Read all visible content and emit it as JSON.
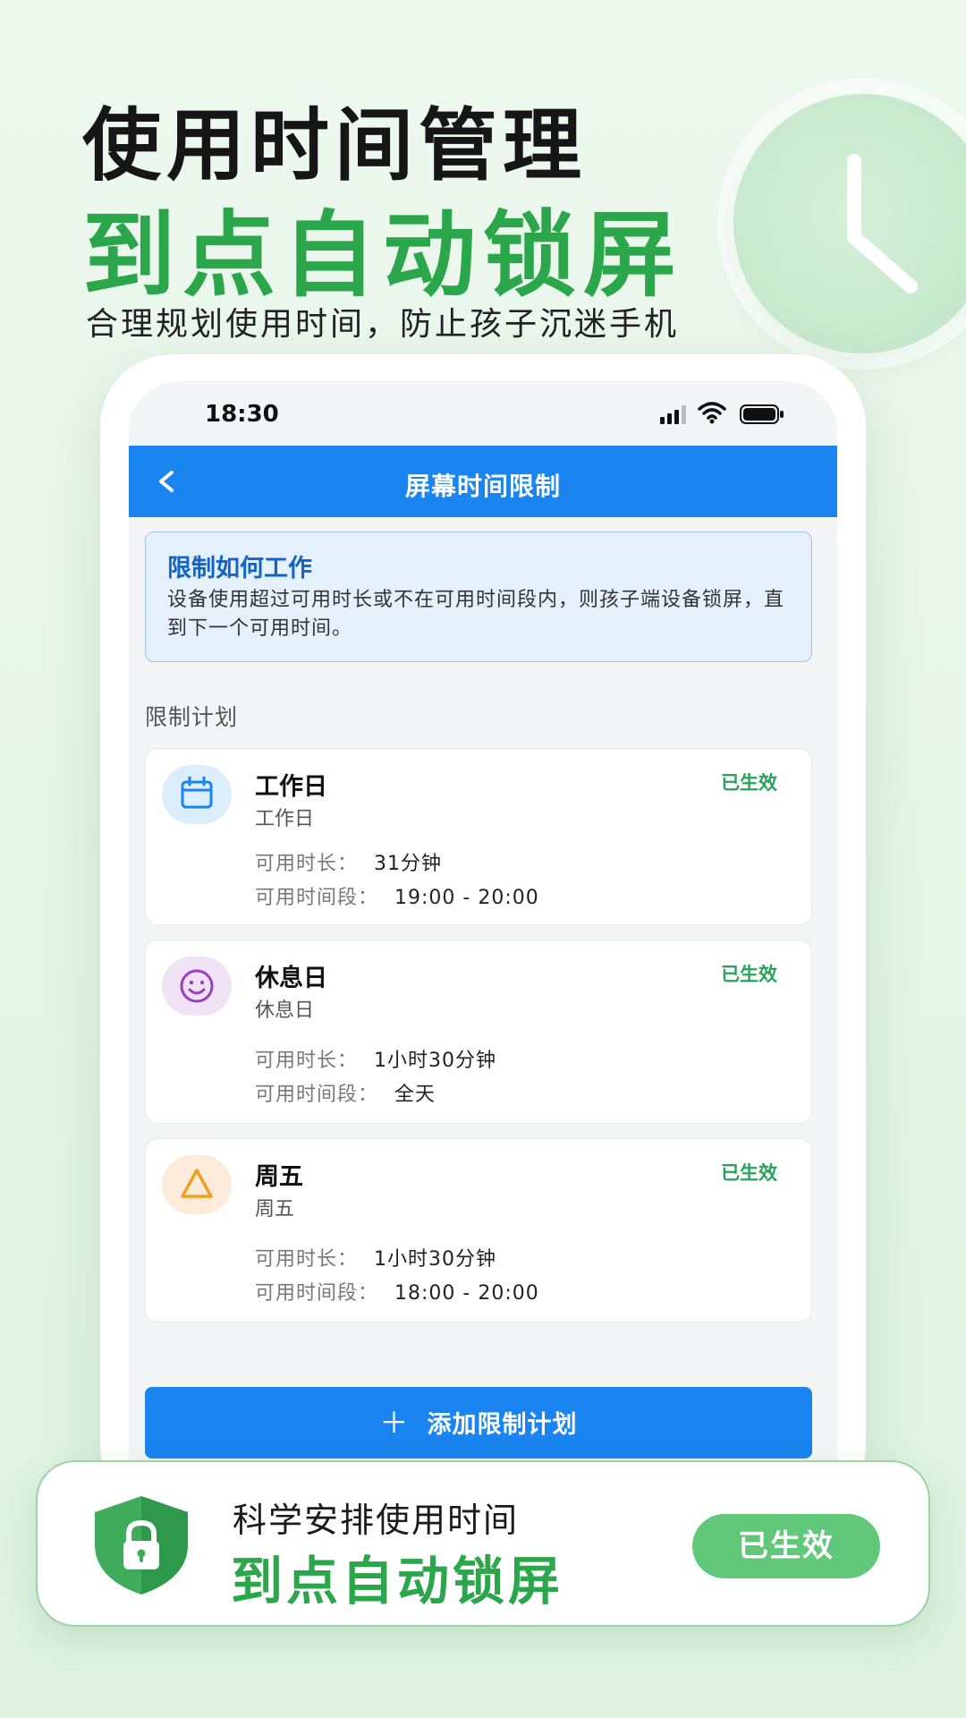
{
  "hero": {
    "title": "使用时间管理",
    "highlight": "到点自动锁屏",
    "subtitle": "合理规划使用时间，防止孩子沉迷手机"
  },
  "status_bar": {
    "time": "18:30"
  },
  "navbar": {
    "title": "屏幕时间限制"
  },
  "info_box": {
    "title": "限制如何工作",
    "body": "设备使用超过可用时长或不在可用时间段内，则孩子端设备锁屏，直到下一个可用时间。"
  },
  "section_title": "限制计划",
  "plans": [
    {
      "icon": "calendar-icon",
      "name": "工作日",
      "sub": "工作日",
      "status": "已生效",
      "duration_label": "可用时长：",
      "duration": "31分钟",
      "period_label": "可用时间段：",
      "period": "19:00 - 20:00"
    },
    {
      "icon": "smiley-icon",
      "name": "休息日",
      "sub": "休息日",
      "status": "已生效",
      "duration_label": "可用时长：",
      "duration": "1小时30分钟",
      "period_label": "可用时间段：",
      "period": "全天"
    },
    {
      "icon": "triangle-icon",
      "name": "周五",
      "sub": "周五",
      "status": "已生效",
      "duration_label": "可用时长：",
      "duration": "1小时30分钟",
      "period_label": "可用时间段：",
      "period": "18:00 - 20:00"
    }
  ],
  "add_button": {
    "plus": "＋",
    "label": "添加限制计划"
  },
  "banner": {
    "line1": "科学安排使用时间",
    "line2": "到点自动锁屏",
    "pill": "已生效"
  },
  "colors": {
    "brand_green": "#2ba64a",
    "nav_blue": "#1a84f0",
    "status_green": "#29a35a",
    "info_bg": "#e4f0fc"
  }
}
